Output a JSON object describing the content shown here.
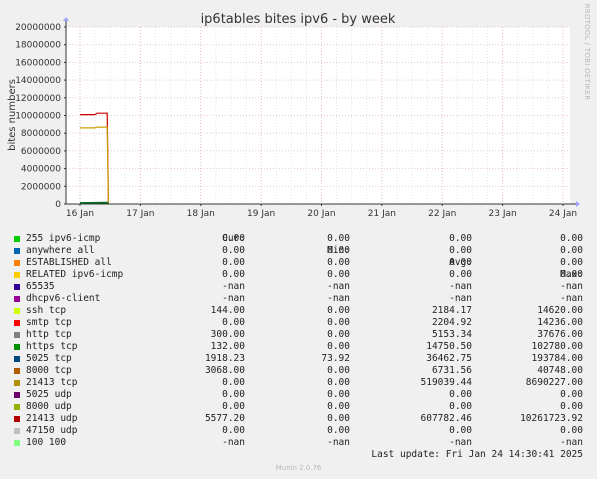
{
  "chart_data": {
    "type": "line",
    "title": "ip6tables bites ipv6 - by week",
    "ylabel": "bites numbers",
    "xlabel": "",
    "ylim": [
      0,
      20000000
    ],
    "yticks": [
      "0",
      "2000000",
      "4000000",
      "6000000",
      "8000000",
      "10000000",
      "12000000",
      "14000000",
      "16000000",
      "18000000",
      "20000000"
    ],
    "xticks": [
      "16 Jan",
      "17 Jan",
      "18 Jan",
      "19 Jan",
      "20 Jan",
      "21 Jan",
      "22 Jan",
      "23 Jan",
      "24 Jan"
    ],
    "grid": true,
    "series_points": [
      {
        "name": "21413 udp",
        "color": "#cc0000",
        "points": [
          [
            0,
            10100000
          ],
          [
            0.25,
            10100000
          ],
          [
            0.28,
            10260000
          ],
          [
            0.45,
            10260000
          ],
          [
            0.47,
            0
          ]
        ]
      },
      {
        "name": "21413 tcp",
        "color": "#c8a000",
        "points": [
          [
            0,
            8600000
          ],
          [
            0.25,
            8600000
          ],
          [
            0.28,
            8690000
          ],
          [
            0.45,
            8690000
          ],
          [
            0.47,
            0
          ]
        ]
      },
      {
        "name": "5025 tcp",
        "color": "#005a5a",
        "points": [
          [
            0,
            150000
          ],
          [
            0.45,
            190000
          ],
          [
            0.47,
            0
          ]
        ]
      },
      {
        "name": "https tcp",
        "color": "#007a00",
        "points": [
          [
            0,
            90000
          ],
          [
            0.45,
            100000
          ],
          [
            0.47,
            0
          ]
        ]
      }
    ]
  },
  "legend": {
    "headers": {
      "cur": "Cur:",
      "min": "Min:",
      "avg": "Avg:",
      "max": "Max:"
    },
    "rows": [
      {
        "color": "#00cc00",
        "name": "255 ipv6-icmp",
        "cur": "0.00",
        "min": "0.00",
        "avg": "0.00",
        "max": "0.00"
      },
      {
        "color": "#0066b3",
        "name": "anywhere all",
        "cur": "0.00",
        "min": "0.00",
        "avg": "0.00",
        "max": "0.00"
      },
      {
        "color": "#ff8000",
        "name": "ESTABLISHED all",
        "cur": "0.00",
        "min": "0.00",
        "avg": "0.00",
        "max": "0.00"
      },
      {
        "color": "#ffcc00",
        "name": "RELATED ipv6-icmp",
        "cur": "0.00",
        "min": "0.00",
        "avg": "0.00",
        "max": "0.00"
      },
      {
        "color": "#330099",
        "name": "65535",
        "cur": "-nan",
        "min": "-nan",
        "avg": "-nan",
        "max": "-nan"
      },
      {
        "color": "#990099",
        "name": "dhcpv6-client",
        "cur": "-nan",
        "min": "-nan",
        "avg": "-nan",
        "max": "-nan"
      },
      {
        "color": "#ccff00",
        "name": "ssh tcp",
        "cur": "144.00",
        "min": "0.00",
        "avg": "2184.17",
        "max": "14620.00"
      },
      {
        "color": "#ff0000",
        "name": "smtp tcp",
        "cur": "0.00",
        "min": "0.00",
        "avg": "2204.92",
        "max": "14236.00"
      },
      {
        "color": "#808080",
        "name": "http tcp",
        "cur": "300.00",
        "min": "0.00",
        "avg": "5153.34",
        "max": "37676.00"
      },
      {
        "color": "#008f00",
        "name": "https tcp",
        "cur": "132.00",
        "min": "0.00",
        "avg": "14750.50",
        "max": "102780.00"
      },
      {
        "color": "#00487d",
        "name": "5025 tcp",
        "cur": "1918.23",
        "min": "73.92",
        "avg": "36462.75",
        "max": "193784.00"
      },
      {
        "color": "#b35a00",
        "name": "8000 tcp",
        "cur": "3068.00",
        "min": "0.00",
        "avg": "6731.56",
        "max": "40748.00"
      },
      {
        "color": "#b38f00",
        "name": "21413 tcp",
        "cur": "0.00",
        "min": "0.00",
        "avg": "519039.44",
        "max": "8690227.00"
      },
      {
        "color": "#6b006b",
        "name": "5025 udp",
        "cur": "0.00",
        "min": "0.00",
        "avg": "0.00",
        "max": "0.00"
      },
      {
        "color": "#8fb300",
        "name": "8000 udp",
        "cur": "0.00",
        "min": "0.00",
        "avg": "0.00",
        "max": "0.00"
      },
      {
        "color": "#b30000",
        "name": "21413 udp",
        "cur": "5577.20",
        "min": "0.00",
        "avg": "607782.46",
        "max": "10261723.92"
      },
      {
        "color": "#bebebe",
        "name": "47150 udp",
        "cur": "0.00",
        "min": "0.00",
        "avg": "0.00",
        "max": "0.00"
      },
      {
        "color": "#80ff80",
        "name": "100 100",
        "cur": "-nan",
        "min": "-nan",
        "avg": "-nan",
        "max": "-nan"
      }
    ]
  },
  "side_label": "RRDTOOL / TOBI OETIKER",
  "footer": {
    "last_update": "Last update: Fri Jan 24 14:30:41 2025",
    "version": "Munin 2.0.76"
  }
}
